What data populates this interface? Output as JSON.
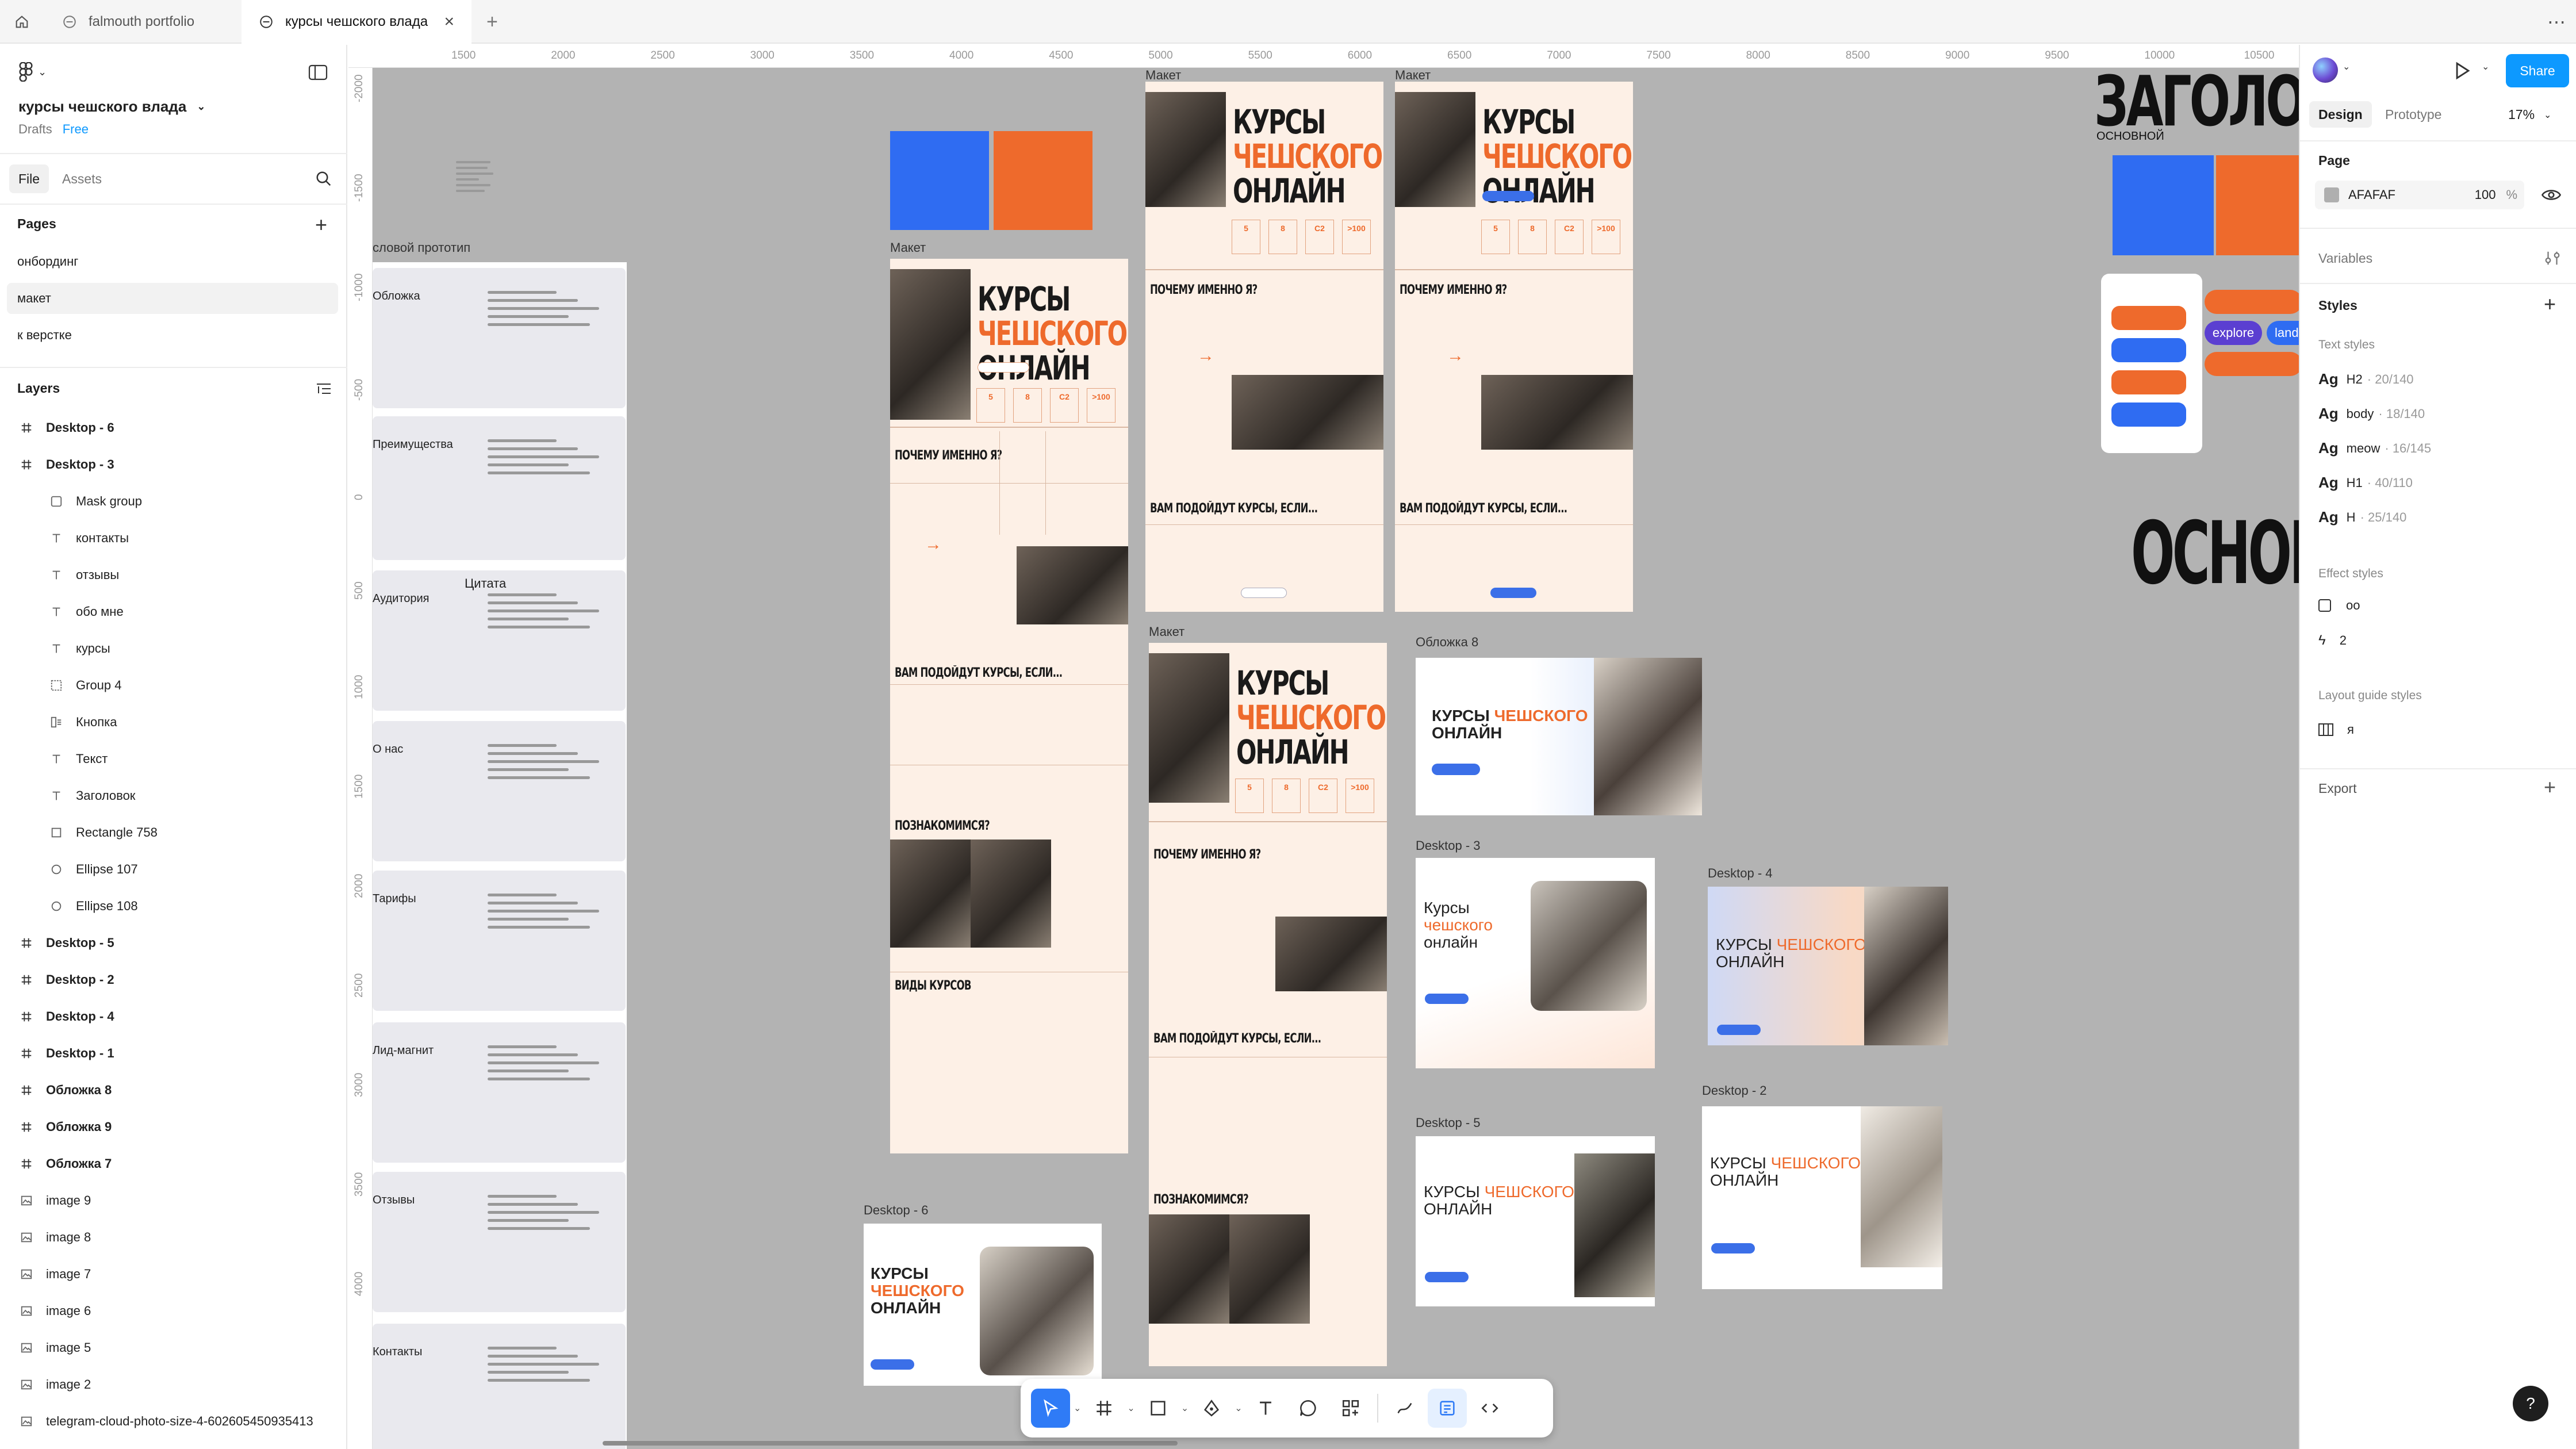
{
  "tabs": {
    "home_label": "home",
    "items": [
      {
        "label": "falmouth portfolio",
        "active": false
      },
      {
        "label": "курсы чешского влада",
        "active": true
      }
    ],
    "add_label": "+",
    "more_label": "⋯"
  },
  "file": {
    "name": "курсы чешского влада",
    "location": "Drafts",
    "plan_badge": "Free"
  },
  "left_panel": {
    "tabs": [
      "File",
      "Assets"
    ],
    "pages_header": "Pages",
    "pages": [
      {
        "label": "онбординг",
        "selected": false
      },
      {
        "label": "макет",
        "selected": true
      },
      {
        "label": "к верстке",
        "selected": false
      }
    ],
    "layers_header": "Layers",
    "layers": [
      {
        "label": "Desktop - 6",
        "type": "frame",
        "indent": 0
      },
      {
        "label": "Desktop - 3",
        "type": "frame",
        "indent": 0
      },
      {
        "label": "Mask group",
        "type": "mask",
        "indent": 1
      },
      {
        "label": "контакты",
        "type": "text",
        "indent": 1
      },
      {
        "label": "отзывы",
        "type": "text",
        "indent": 1
      },
      {
        "label": "обо мне",
        "type": "text",
        "indent": 1
      },
      {
        "label": "курсы",
        "type": "text",
        "indent": 1
      },
      {
        "label": "Group 4",
        "type": "group",
        "indent": 1
      },
      {
        "label": "Кнопка",
        "type": "component",
        "indent": 1
      },
      {
        "label": "Текст",
        "type": "text",
        "indent": 1
      },
      {
        "label": "Заголовок",
        "type": "text",
        "indent": 1
      },
      {
        "label": "Rectangle 758",
        "type": "rect",
        "indent": 1
      },
      {
        "label": "Ellipse 107",
        "type": "ellipse",
        "indent": 1
      },
      {
        "label": "Ellipse 108",
        "type": "ellipse",
        "indent": 1
      },
      {
        "label": "Desktop - 5",
        "type": "frame",
        "indent": 0
      },
      {
        "label": "Desktop - 2",
        "type": "frame",
        "indent": 0
      },
      {
        "label": "Desktop - 4",
        "type": "frame",
        "indent": 0
      },
      {
        "label": "Desktop - 1",
        "type": "frame",
        "indent": 0
      },
      {
        "label": "Обложка 8",
        "type": "frame",
        "indent": 0
      },
      {
        "label": "Обложка 9",
        "type": "frame",
        "indent": 0
      },
      {
        "label": "Обложка 7",
        "type": "frame",
        "indent": 0
      },
      {
        "label": "image 9",
        "type": "image",
        "indent": 0
      },
      {
        "label": "image 8",
        "type": "image",
        "indent": 0
      },
      {
        "label": "image 7",
        "type": "image",
        "indent": 0
      },
      {
        "label": "image 6",
        "type": "image",
        "indent": 0
      },
      {
        "label": "image 5",
        "type": "image",
        "indent": 0
      },
      {
        "label": "image 2",
        "type": "image",
        "indent": 0
      },
      {
        "label": "telegram-cloud-photo-size-4-602605450935413",
        "type": "image",
        "indent": 0
      }
    ]
  },
  "rulers": {
    "top": [
      "1500",
      "2000",
      "2500",
      "3000",
      "3500",
      "4000",
      "4500",
      "5000",
      "5500",
      "6000",
      "6500",
      "7000",
      "7500",
      "8000",
      "8500",
      "9000",
      "9500",
      "10000",
      "10500"
    ],
    "left": [
      "-2000",
      "-1500",
      "-1000",
      "-500",
      "0",
      "500",
      "1000",
      "1500",
      "2000",
      "2500",
      "3000",
      "3500",
      "4000"
    ]
  },
  "canvas": {
    "proto_label": "словой прототип",
    "quote_label": "Цитата",
    "proto_cards": [
      {
        "title": "Обложка"
      },
      {
        "title": "Преимущества"
      },
      {
        "title": "Аудитория"
      },
      {
        "title": "О нас"
      },
      {
        "title": "Тарифы"
      },
      {
        "title": "Лид-магнит"
      },
      {
        "title": "Отзывы"
      },
      {
        "title": "Контакты"
      }
    ],
    "frame_labels": {
      "maket_1": "Макет",
      "maket_2": "Макет",
      "maket_3": "Макет",
      "maket_4": "Макет",
      "cover8": "Обложка 8",
      "d3": "Desktop - 3",
      "d4": "Desktop - 4",
      "d5": "Desktop - 5",
      "d2": "Desktop - 2",
      "d6": "Desktop - 6"
    },
    "mockup": {
      "title_a": "КУРСЫ",
      "title_b": "ЧЕШСКОГО",
      "title_c": "ОНЛАЙН",
      "why": "ПОЧЕМУ ИМЕННО Я?",
      "fit": "ВАМ ПОДОЙДУТ КУРСЫ, ЕСЛИ...",
      "meet": "ПОЗНАКОМИМСЯ?",
      "kinds": "ВИДЫ КУРСОВ",
      "stats": [
        "5",
        "8",
        "C2",
        ">100"
      ]
    },
    "cover": {
      "title_a": "КУРСЫ",
      "title_b": "ЧЕШСКОГО",
      "title_c": "ОНЛАЙН",
      "title_cap_a": "Курсы",
      "title_cap_b": "чешского",
      "title_cap_c": "онлайн"
    },
    "side_heading": "ЗАГОЛОВО",
    "side_sub": "ОСНОВНОЙ",
    "side_big": "ОСНОВНОЙ",
    "pill_labels": [
      "explore",
      "land"
    ]
  },
  "right_panel": {
    "share_label": "Share",
    "design_tab": "Design",
    "prototype_tab": "Prototype",
    "zoom": "17%",
    "page_header": "Page",
    "page_color": "AFAFAF",
    "page_opacity": "100",
    "page_opacity_unit": "%",
    "variables_header": "Variables",
    "styles_header": "Styles",
    "text_styles_header": "Text styles",
    "text_styles": [
      {
        "name": "H2",
        "meta": "20/140"
      },
      {
        "name": "body",
        "meta": "18/140"
      },
      {
        "name": "meow",
        "meta": "16/145"
      },
      {
        "name": "H1",
        "meta": "40/110"
      },
      {
        "name": "H",
        "meta": "25/140"
      }
    ],
    "text_style_prefix": "Ag",
    "effect_styles_header": "Effect styles",
    "effect_styles": [
      {
        "name": "oo",
        "icon": "square-icon"
      },
      {
        "name": "2",
        "icon": "lightning-icon"
      }
    ],
    "layout_guide_header": "Layout guide styles",
    "layout_guides": [
      {
        "name": "я"
      }
    ],
    "export_header": "Export"
  },
  "help_label": "?",
  "colors": {
    "accent": "#0d99ff",
    "orange": "#ee6a2c",
    "blue": "#2f6cf2",
    "canvas_bg": "#b3b3b3",
    "frame_bg": "#fdf0e6"
  }
}
